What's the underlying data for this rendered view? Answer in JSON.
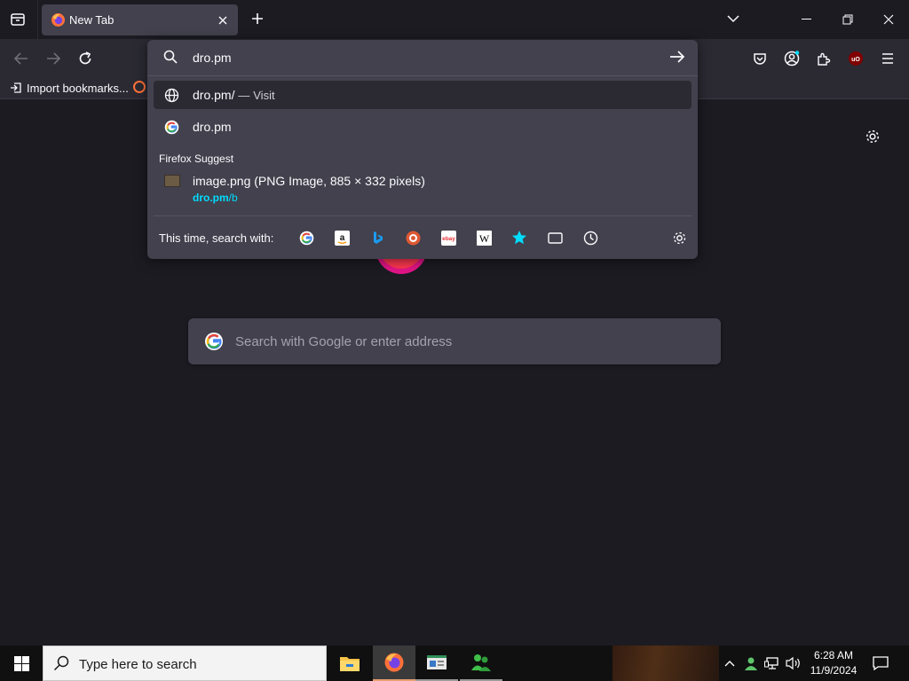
{
  "tab": {
    "title": "New Tab"
  },
  "bookmarks": {
    "import_label": "Import bookmarks..."
  },
  "urlbar": {
    "input_value": "dro.pm",
    "visit_row": {
      "url": "dro.pm/",
      "separator": "—",
      "action": "Visit"
    },
    "google_row": {
      "text": "dro.pm"
    },
    "suggest_heading": "Firefox Suggest",
    "image_row": {
      "title": "image.png (PNG Image, 885 × 332 pixels)",
      "domain": "dro.pm",
      "path": "/b"
    },
    "oneoff_label": "This time, search with:",
    "oneoff_engines": [
      "google-icon",
      "amazon-icon",
      "bing-icon",
      "duckduckgo-icon",
      "ebay-icon",
      "wikipedia-icon",
      "bookmarks-star-icon",
      "tabs-icon",
      "history-icon",
      "search-settings-gear-icon"
    ]
  },
  "page": {
    "search_placeholder": "Search with Google or enter address"
  },
  "taskbar": {
    "search_placeholder": "Type here to search",
    "time": "6:28 AM",
    "date": "11/9/2024"
  },
  "colors": {
    "background": "#1c1b22",
    "toolbar": "#2b2a33",
    "panel": "#42414d",
    "link": "#00ddff"
  }
}
